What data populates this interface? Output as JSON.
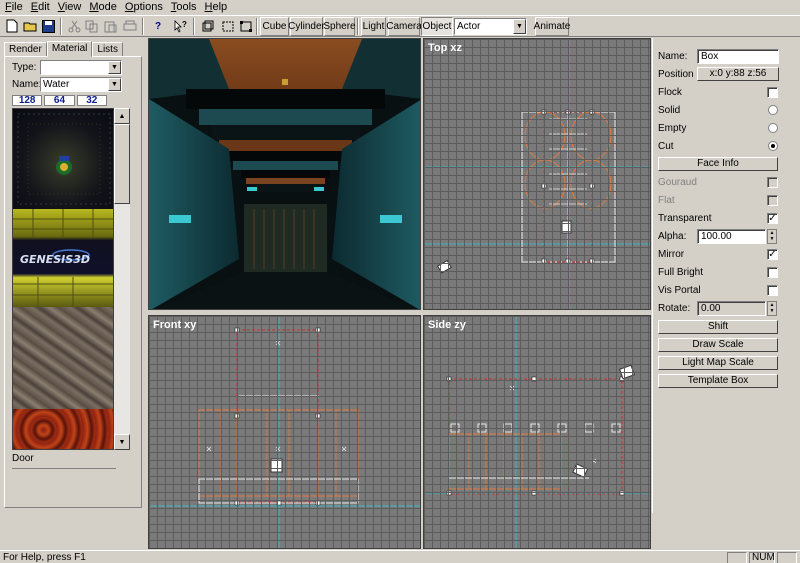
{
  "menu": [
    "File",
    "Edit",
    "View",
    "Mode",
    "Options",
    "Tools",
    "Help"
  ],
  "toolbar": {
    "icons": [
      "new-file-icon",
      "open-folder-icon",
      "save-icon",
      "cut-icon",
      "copy-icon",
      "paste-icon",
      "print-icon",
      "help-icon",
      "context-help-icon"
    ],
    "brush_buttons": [
      "Cube",
      "Cylinder",
      "Sphere",
      "Light",
      "Camera",
      "Object"
    ],
    "entity_select": "Actor",
    "animate": "Animate"
  },
  "left_panel": {
    "tabs": [
      "Render",
      "Material",
      "Lists"
    ],
    "active_tab": "Material",
    "type_label": "Type:",
    "type_value": "",
    "name_label": "Name:",
    "name_value": "Water",
    "sizes": [
      "128",
      "64",
      "32"
    ],
    "texture_logo": "GENESIS3D",
    "texture_name": "Door"
  },
  "viewports": {
    "top": "Top xz",
    "front": "Front xy",
    "side": "Side zy"
  },
  "properties": {
    "name_label": "Name:",
    "name_value": "Box",
    "position_label": "Position",
    "position_value": "x:0 y:88 z:56",
    "flags": [
      {
        "label": "Flock",
        "kind": "check",
        "checked": false
      },
      {
        "label": "Solid",
        "kind": "radio",
        "checked": false
      },
      {
        "label": "Empty",
        "kind": "radio",
        "checked": false
      },
      {
        "label": "Cut",
        "kind": "radio",
        "checked": true
      }
    ],
    "face_info": "Face Info",
    "face_flags": [
      {
        "label": "Gouraud",
        "checked": false,
        "disabled": true
      },
      {
        "label": "Flat",
        "checked": false,
        "disabled": true
      },
      {
        "label": "Transparent",
        "checked": true,
        "disabled": false
      }
    ],
    "alpha_label": "Alpha:",
    "alpha_value": "100.00",
    "face_flags2": [
      {
        "label": "Mirror",
        "checked": true
      },
      {
        "label": "Full Bright",
        "checked": false
      },
      {
        "label": "Vis Portal",
        "checked": false
      }
    ],
    "rotate_label": "Rotate:",
    "rotate_value": "0.00",
    "buttons": [
      "Shift",
      "Draw Scale",
      "Light Map Scale",
      "Template Box"
    ]
  },
  "status": {
    "help": "For Help, press F1",
    "num": "NUM"
  },
  "colors": {
    "face": "#d4d0c8",
    "grid": "#7a7a7a",
    "brush_orange": "#e07a40",
    "cut_red": "#c83232",
    "axis_cyan": "#3ab5c0"
  }
}
